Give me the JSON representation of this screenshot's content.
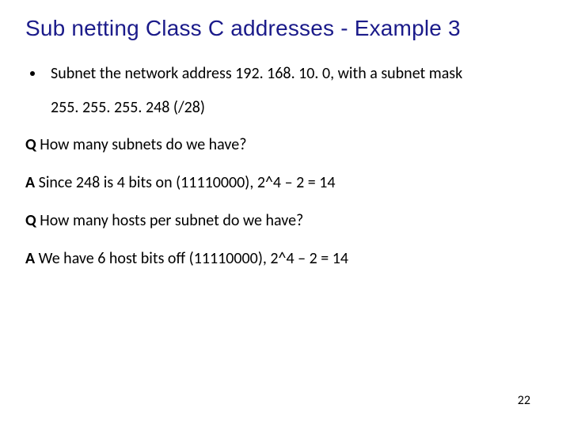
{
  "title": "Sub netting Class C addresses - Example 3",
  "bullet": {
    "line1": "Subnet the network address 192. 168. 10. 0, with a subnet mask",
    "line2": "255. 255. 255. 248 (/28)"
  },
  "qa": [
    {
      "label": "Q",
      "text": " How many subnets do we have?"
    },
    {
      "label": "A",
      "text": " Since 248 is 4 bits on (11110000), 2^4 – 2 = 14"
    },
    {
      "label": "Q",
      "text": " How many hosts per subnet do we have?"
    },
    {
      "label": "A",
      "text": " We have 6 host bits off (11110000), 2^4 – 2 = 14"
    }
  ],
  "page_number": "22"
}
